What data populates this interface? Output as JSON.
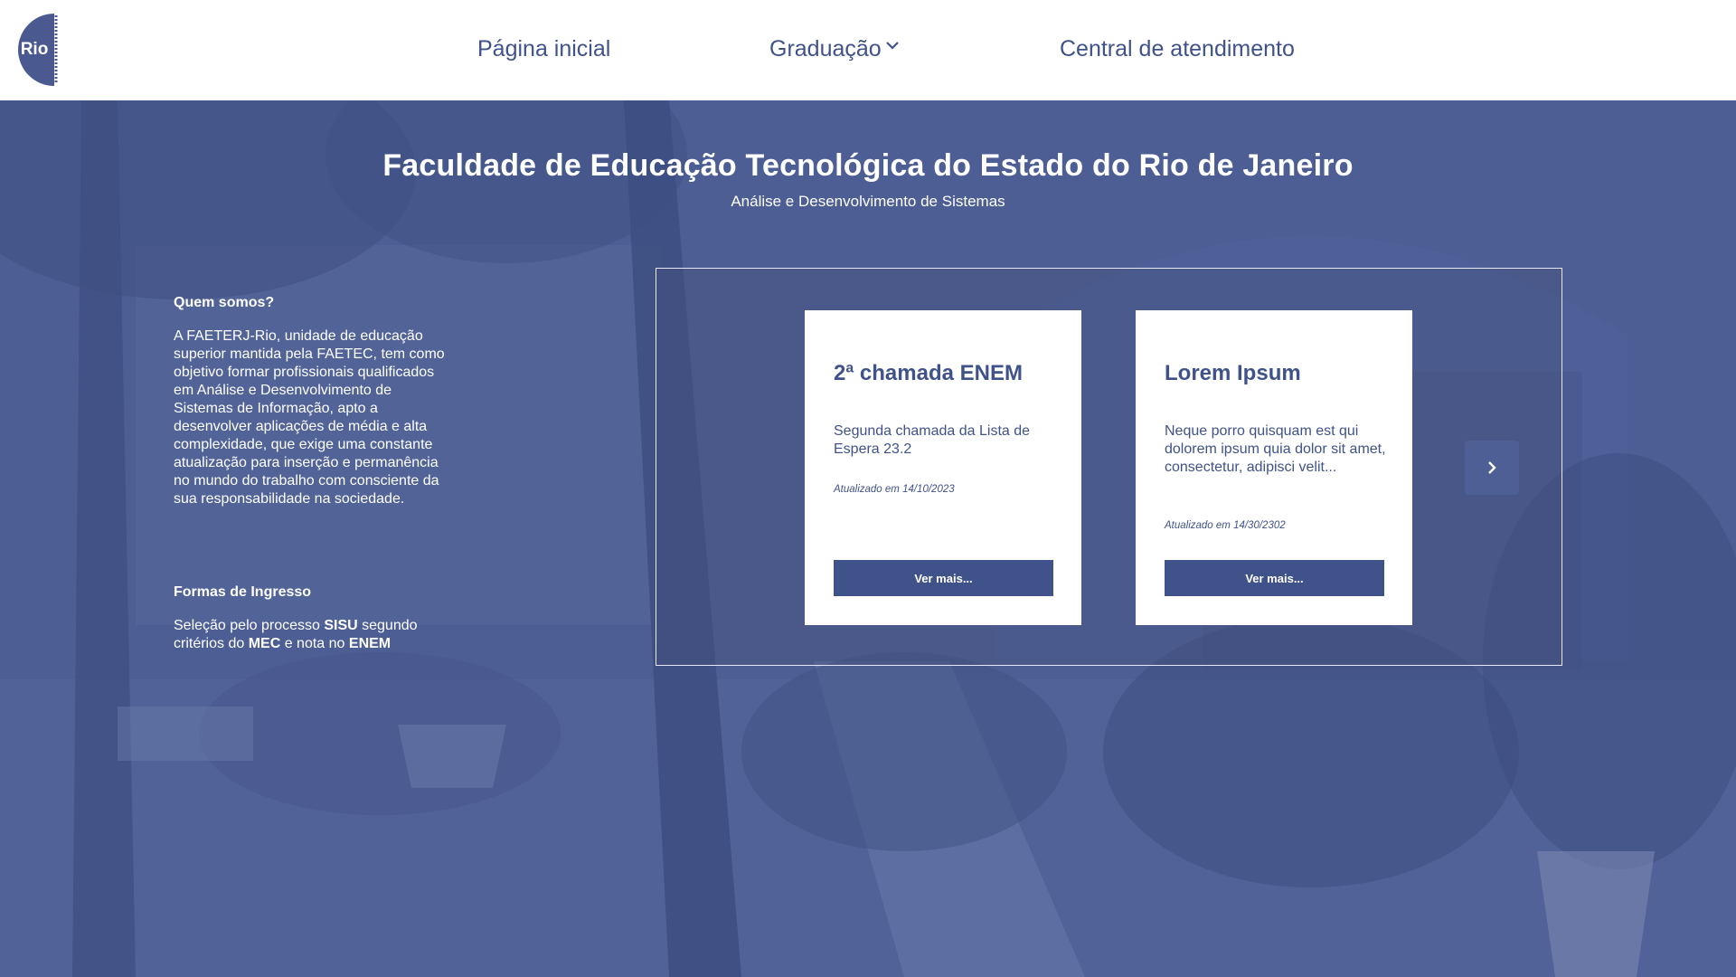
{
  "header": {
    "logo_text": "Rio",
    "nav": {
      "home": "Página inicial",
      "graduacao": "Graduação",
      "central": "Central de atendimento"
    }
  },
  "hero": {
    "title": "Faculdade de Educação Tecnológica do Estado do Rio de Janeiro",
    "subtitle": "Análise e Desenvolvimento de Sistemas"
  },
  "about": {
    "heading": "Quem somos?",
    "text": "A FAETERJ-Rio, unidade de educação superior mantida pela FAETEC, tem como objetivo formar profissionais qualificados em Análise e Desenvolvimento de Sistemas de Informação, apto a desenvolver aplicações de média e alta complexidade, que exige uma constante atualização para inserção e permanência no mundo do trabalho com consciente da sua responsabilidade na sociedade."
  },
  "ingresso": {
    "heading": "Formas de Ingresso",
    "part1": "Seleção pelo processo ",
    "sisu": "SISU",
    "part2": " segundo critérios do ",
    "mec": "MEC",
    "part3": " e nota no ",
    "enem": "ENEM"
  },
  "cards": [
    {
      "title": "2ª chamada ENEM",
      "text": "Segunda chamada da Lista de Espera 23.2",
      "date": "Atualizado em 14/10/2023",
      "button": "Ver mais..."
    },
    {
      "title": "Lorem Ipsum",
      "text": "Neque porro quisquam est qui dolorem ipsum quia dolor sit amet, consectetur, adipisci velit...",
      "date": "Atualizado em 14/30/2302",
      "button": "Ver mais..."
    }
  ],
  "icons": {
    "chevron": "chevron-down-icon",
    "next": "chevron-right-icon"
  },
  "colors": {
    "brand": "#40528a",
    "hero_bg": "#4c5d93",
    "header_bg": "#ffffff"
  }
}
